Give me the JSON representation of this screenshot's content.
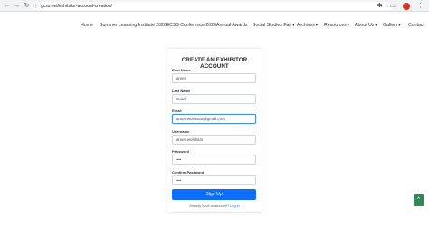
{
  "browser": {
    "url": "gcss.net/exhibitor-account-creation/",
    "back_icon": "←",
    "forward_icon": "→",
    "reload_icon": "↻",
    "home_icon": "⌂"
  },
  "nav": {
    "items": [
      {
        "label": "Home",
        "has_caret": false
      },
      {
        "label": "Summer Learning Institute 2026",
        "has_caret": false
      },
      {
        "label": "GCSS Conference 2026",
        "has_caret": false
      },
      {
        "label": "Annual Awards",
        "has_caret": false
      },
      {
        "label": "Social Studies Fair",
        "has_caret": true
      },
      {
        "label": "Archives",
        "has_caret": true
      },
      {
        "label": "Resources",
        "has_caret": true
      },
      {
        "label": "About Us",
        "has_caret": true
      },
      {
        "label": "Gallery",
        "has_caret": true
      },
      {
        "label": "Contact",
        "has_caret": false
      }
    ],
    "caret": "▾"
  },
  "form": {
    "title": "CREATE AN EXHIBITOR ACCOUNT",
    "first_name": {
      "label": "First Name",
      "value": "james"
    },
    "last_name": {
      "label": "Last Name",
      "value": "stuart"
    },
    "email": {
      "label": "Email",
      "value": "james.weildstar@gmail.com"
    },
    "username": {
      "label": "Username",
      "value": "james.weildstar"
    },
    "password": {
      "label": "Password",
      "value": "••••"
    },
    "confirm_password": {
      "label": "Confirm Password",
      "value": "••••"
    },
    "submit_label": "Sign Up",
    "login_prompt": "Already have an account?",
    "login_link": "Log in"
  },
  "scroll_top_icon": "⌃",
  "colors": {
    "primary": "#0d6efd",
    "scroll_top": "#2e8b57",
    "focus": "#4a90e2"
  }
}
